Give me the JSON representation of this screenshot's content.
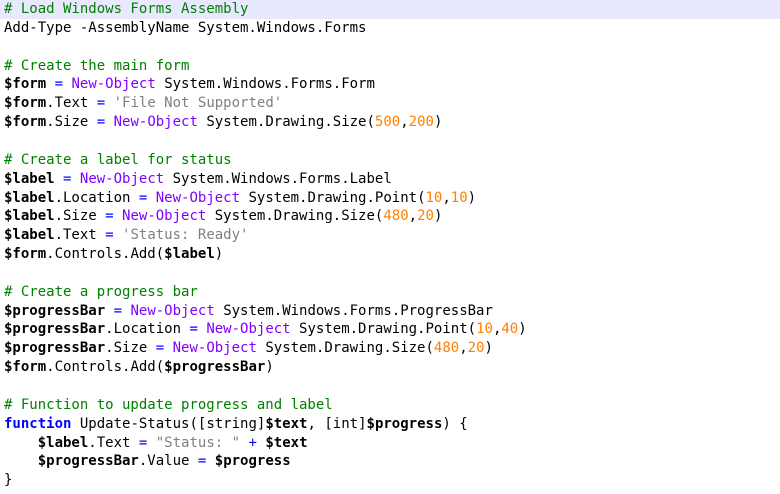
{
  "editor": {
    "colors": {
      "comment": "#008000",
      "keyword": "#0000ff",
      "cmdlet": "#8000ff",
      "string": "#808080",
      "number": "#ff8000",
      "current_line_bg": "#e8e8ff"
    },
    "lines": [
      [
        {
          "t": "cm",
          "v": "# Load Windows Forms Assembly"
        }
      ],
      [
        {
          "t": "pl",
          "v": "Add-Type -AssemblyName System.Windows.Forms"
        }
      ],
      [],
      [
        {
          "t": "cm",
          "v": "# Create the main form"
        }
      ],
      [
        {
          "t": "vr",
          "v": "$form"
        },
        {
          "t": "pl",
          "v": " "
        },
        {
          "t": "op",
          "v": "="
        },
        {
          "t": "pl",
          "v": " "
        },
        {
          "t": "fn",
          "v": "New-Object"
        },
        {
          "t": "pl",
          "v": " System.Windows.Forms.Form"
        }
      ],
      [
        {
          "t": "vr",
          "v": "$form"
        },
        {
          "t": "pl",
          "v": ".Text "
        },
        {
          "t": "op",
          "v": "="
        },
        {
          "t": "pl",
          "v": " "
        },
        {
          "t": "st",
          "v": "'File Not Supported'"
        }
      ],
      [
        {
          "t": "vr",
          "v": "$form"
        },
        {
          "t": "pl",
          "v": ".Size "
        },
        {
          "t": "op",
          "v": "="
        },
        {
          "t": "pl",
          "v": " "
        },
        {
          "t": "fn",
          "v": "New-Object"
        },
        {
          "t": "pl",
          "v": " System.Drawing.Size"
        },
        {
          "t": "pn",
          "v": "("
        },
        {
          "t": "nm",
          "v": "500"
        },
        {
          "t": "pn",
          "v": ","
        },
        {
          "t": "nm",
          "v": "200"
        },
        {
          "t": "pn",
          "v": ")"
        }
      ],
      [],
      [
        {
          "t": "cm",
          "v": "# Create a label for status"
        }
      ],
      [
        {
          "t": "vr",
          "v": "$label"
        },
        {
          "t": "pl",
          "v": " "
        },
        {
          "t": "op",
          "v": "="
        },
        {
          "t": "pl",
          "v": " "
        },
        {
          "t": "fn",
          "v": "New-Object"
        },
        {
          "t": "pl",
          "v": " System.Windows.Forms.Label"
        }
      ],
      [
        {
          "t": "vr",
          "v": "$label"
        },
        {
          "t": "pl",
          "v": ".Location "
        },
        {
          "t": "op",
          "v": "="
        },
        {
          "t": "pl",
          "v": " "
        },
        {
          "t": "fn",
          "v": "New-Object"
        },
        {
          "t": "pl",
          "v": " System.Drawing.Point"
        },
        {
          "t": "pn",
          "v": "("
        },
        {
          "t": "nm",
          "v": "10"
        },
        {
          "t": "pn",
          "v": ","
        },
        {
          "t": "nm",
          "v": "10"
        },
        {
          "t": "pn",
          "v": ")"
        }
      ],
      [
        {
          "t": "vr",
          "v": "$label"
        },
        {
          "t": "pl",
          "v": ".Size "
        },
        {
          "t": "op",
          "v": "="
        },
        {
          "t": "pl",
          "v": " "
        },
        {
          "t": "fn",
          "v": "New-Object"
        },
        {
          "t": "pl",
          "v": " System.Drawing.Size"
        },
        {
          "t": "pn",
          "v": "("
        },
        {
          "t": "nm",
          "v": "480"
        },
        {
          "t": "pn",
          "v": ","
        },
        {
          "t": "nm",
          "v": "20"
        },
        {
          "t": "pn",
          "v": ")"
        }
      ],
      [
        {
          "t": "vr",
          "v": "$label"
        },
        {
          "t": "pl",
          "v": ".Text "
        },
        {
          "t": "op",
          "v": "="
        },
        {
          "t": "pl",
          "v": " "
        },
        {
          "t": "st",
          "v": "'Status: Ready'"
        }
      ],
      [
        {
          "t": "vr",
          "v": "$form"
        },
        {
          "t": "pl",
          "v": ".Controls.Add"
        },
        {
          "t": "pn",
          "v": "("
        },
        {
          "t": "vr",
          "v": "$label"
        },
        {
          "t": "pn",
          "v": ")"
        }
      ],
      [],
      [
        {
          "t": "cm",
          "v": "# Create a progress bar"
        }
      ],
      [
        {
          "t": "vr",
          "v": "$progressBar"
        },
        {
          "t": "pl",
          "v": " "
        },
        {
          "t": "op",
          "v": "="
        },
        {
          "t": "pl",
          "v": " "
        },
        {
          "t": "fn",
          "v": "New-Object"
        },
        {
          "t": "pl",
          "v": " System.Windows.Forms.ProgressBar"
        }
      ],
      [
        {
          "t": "vr",
          "v": "$progressBar"
        },
        {
          "t": "pl",
          "v": ".Location "
        },
        {
          "t": "op",
          "v": "="
        },
        {
          "t": "pl",
          "v": " "
        },
        {
          "t": "fn",
          "v": "New-Object"
        },
        {
          "t": "pl",
          "v": " System.Drawing.Point"
        },
        {
          "t": "pn",
          "v": "("
        },
        {
          "t": "nm",
          "v": "10"
        },
        {
          "t": "pn",
          "v": ","
        },
        {
          "t": "nm",
          "v": "40"
        },
        {
          "t": "pn",
          "v": ")"
        }
      ],
      [
        {
          "t": "vr",
          "v": "$progressBar"
        },
        {
          "t": "pl",
          "v": ".Size "
        },
        {
          "t": "op",
          "v": "="
        },
        {
          "t": "pl",
          "v": " "
        },
        {
          "t": "fn",
          "v": "New-Object"
        },
        {
          "t": "pl",
          "v": " System.Drawing.Size"
        },
        {
          "t": "pn",
          "v": "("
        },
        {
          "t": "nm",
          "v": "480"
        },
        {
          "t": "pn",
          "v": ","
        },
        {
          "t": "nm",
          "v": "20"
        },
        {
          "t": "pn",
          "v": ")"
        }
      ],
      [
        {
          "t": "vr",
          "v": "$form"
        },
        {
          "t": "pl",
          "v": ".Controls.Add"
        },
        {
          "t": "pn",
          "v": "("
        },
        {
          "t": "vr",
          "v": "$progressBar"
        },
        {
          "t": "pn",
          "v": ")"
        }
      ],
      [],
      [
        {
          "t": "cm",
          "v": "# Function to update progress and label"
        }
      ],
      [
        {
          "t": "kw",
          "v": "function"
        },
        {
          "t": "pl",
          "v": " Update-Status"
        },
        {
          "t": "pn",
          "v": "(["
        },
        {
          "t": "ty",
          "v": "string"
        },
        {
          "t": "pn",
          "v": "]"
        },
        {
          "t": "vr",
          "v": "$text"
        },
        {
          "t": "pn",
          "v": ", ["
        },
        {
          "t": "ty",
          "v": "int"
        },
        {
          "t": "pn",
          "v": "]"
        },
        {
          "t": "vr",
          "v": "$progress"
        },
        {
          "t": "pn",
          "v": ") {"
        }
      ],
      [
        {
          "t": "pl",
          "v": "    "
        },
        {
          "t": "vr",
          "v": "$label"
        },
        {
          "t": "pl",
          "v": ".Text "
        },
        {
          "t": "op",
          "v": "="
        },
        {
          "t": "pl",
          "v": " "
        },
        {
          "t": "st",
          "v": "\"Status: \""
        },
        {
          "t": "pl",
          "v": " "
        },
        {
          "t": "op",
          "v": "+"
        },
        {
          "t": "pl",
          "v": " "
        },
        {
          "t": "vr",
          "v": "$text"
        }
      ],
      [
        {
          "t": "pl",
          "v": "    "
        },
        {
          "t": "vr",
          "v": "$progressBar"
        },
        {
          "t": "pl",
          "v": ".Value "
        },
        {
          "t": "op",
          "v": "="
        },
        {
          "t": "pl",
          "v": " "
        },
        {
          "t": "vr",
          "v": "$progress"
        }
      ],
      [
        {
          "t": "pn",
          "v": "}"
        }
      ]
    ]
  }
}
